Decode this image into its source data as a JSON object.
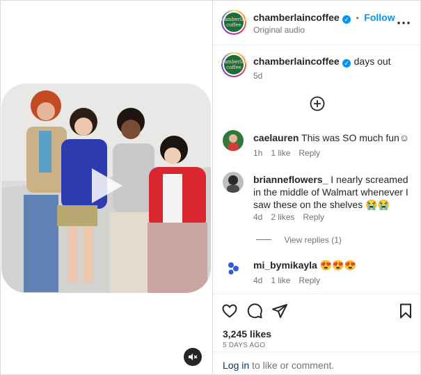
{
  "post": {
    "author": "chamberlaincoffee",
    "follow_label": "Follow",
    "dot": "•",
    "audio": "Original audio",
    "caption": "days out",
    "time": "5d",
    "avatar_text": "chamberlain coffee",
    "verified_glyph": "✓"
  },
  "comments": [
    {
      "user": "caelauren",
      "text": "This was SO much fun☺",
      "time": "1h",
      "likes": "1 like",
      "reply": "Reply"
    },
    {
      "user": "brianneflowers_",
      "text": "I nearly screamed in the middle of Walmart whenever I saw these on the shelves 😭😭",
      "time": "4d",
      "likes": "2 likes",
      "reply": "Reply"
    },
    {
      "user": "mi_bymikayla",
      "text": "😍😍😍",
      "time": "4d",
      "likes": "1 like",
      "reply": "Reply"
    }
  ],
  "view_replies": "View replies (1)",
  "stats": {
    "likes": "3,245 likes",
    "date": "5 DAYS AGO"
  },
  "login": {
    "link": "Log in",
    "rest": " to like or comment."
  },
  "icons": {
    "more": "more-options-icon",
    "add": "add-circle-icon",
    "like": "heart-icon",
    "comment": "comment-icon",
    "share": "share-icon",
    "save": "bookmark-icon",
    "play": "play-icon",
    "mute": "muted-speaker-icon"
  },
  "colors": {
    "accent": "#0095f6",
    "text": "#262626",
    "muted": "#737373",
    "link": "#00376b"
  }
}
